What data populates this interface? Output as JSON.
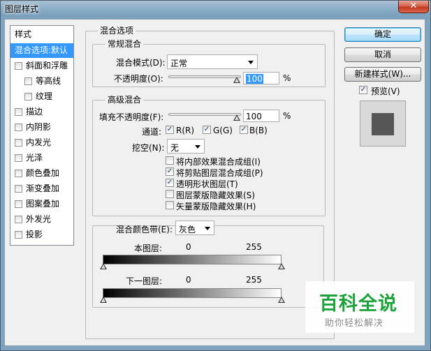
{
  "window": {
    "title": "图层样式",
    "close_glyph": "✕"
  },
  "styles_list": {
    "header": "样式",
    "items": [
      {
        "label": "混合选项:默认",
        "checkbox": false,
        "selected": true,
        "indent": 0
      },
      {
        "label": "斜面和浮雕",
        "checkbox": true,
        "selected": false,
        "indent": 0
      },
      {
        "label": "等高线",
        "checkbox": true,
        "selected": false,
        "indent": 1
      },
      {
        "label": "纹理",
        "checkbox": true,
        "selected": false,
        "indent": 1
      },
      {
        "label": "描边",
        "checkbox": true,
        "selected": false,
        "indent": 0
      },
      {
        "label": "内阴影",
        "checkbox": true,
        "selected": false,
        "indent": 0
      },
      {
        "label": "内发光",
        "checkbox": true,
        "selected": false,
        "indent": 0
      },
      {
        "label": "光泽",
        "checkbox": true,
        "selected": false,
        "indent": 0
      },
      {
        "label": "颜色叠加",
        "checkbox": true,
        "selected": false,
        "indent": 0
      },
      {
        "label": "渐变叠加",
        "checkbox": true,
        "selected": false,
        "indent": 0
      },
      {
        "label": "图案叠加",
        "checkbox": true,
        "selected": false,
        "indent": 0
      },
      {
        "label": "外发光",
        "checkbox": true,
        "selected": false,
        "indent": 0
      },
      {
        "label": "投影",
        "checkbox": true,
        "selected": false,
        "indent": 0
      }
    ]
  },
  "blend_options": {
    "title": "混合选项",
    "general": {
      "title": "常规混合",
      "blend_mode_label": "混合模式(D):",
      "blend_mode_value": "正常",
      "opacity_label": "不透明度(O):",
      "opacity_value": "100",
      "opacity_unit": "%"
    },
    "advanced": {
      "title": "高级混合",
      "fill_opacity_label": "填充不透明度(F):",
      "fill_opacity_value": "100",
      "fill_opacity_unit": "%",
      "channels_label": "通道:",
      "channels": [
        {
          "label": "R(R)",
          "checked": true
        },
        {
          "label": "G(G)",
          "checked": true
        },
        {
          "label": "B(B)",
          "checked": true
        }
      ],
      "knockout_label": "挖空(N):",
      "knockout_value": "无",
      "options": [
        {
          "label": "将内部效果混合成组(I)",
          "checked": false
        },
        {
          "label": "将剪贴图层混合成组(P)",
          "checked": true
        },
        {
          "label": "透明形状图层(T)",
          "checked": true
        },
        {
          "label": "图层蒙版隐藏效果(S)",
          "checked": false
        },
        {
          "label": "矢量蒙版隐藏效果(H)",
          "checked": false
        }
      ]
    },
    "blend_if": {
      "label": "混合颜色带(E):",
      "value": "灰色",
      "this_layer_label": "本图层:",
      "this_layer_low": "0",
      "this_layer_high": "255",
      "underlying_label": "下一图层:",
      "underlying_low": "0",
      "underlying_high": "255"
    }
  },
  "buttons": {
    "ok": "确定",
    "cancel": "取消",
    "new_style": "新建样式(W)...",
    "preview_label": "预览(V)",
    "preview_checked": true
  },
  "watermark": {
    "main": "百科全说",
    "sub": "助你轻松解决"
  },
  "colors": {
    "selection": "#3399ff",
    "watermark_green": "#1ea33c",
    "preview_swatch": "#555555"
  }
}
